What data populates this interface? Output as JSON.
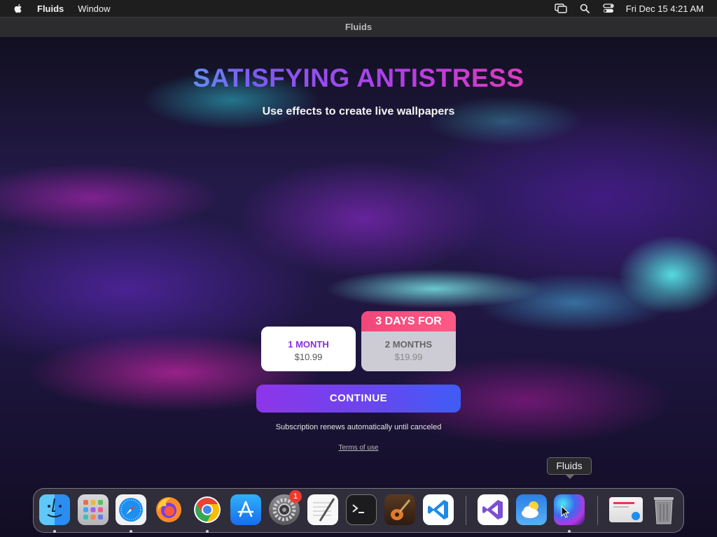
{
  "menubar": {
    "app_name": "Fluids",
    "items": [
      "Window"
    ],
    "clock": "Fri Dec 15  4:21 AM"
  },
  "window": {
    "title": "Fluids"
  },
  "paywall": {
    "headline": "SATISFYING ANTISTRESS",
    "subheadline": "Use effects to create live wallpapers",
    "plans": [
      {
        "name": "1 MONTH",
        "price": "$10.99",
        "selected": true
      },
      {
        "badge": "3 DAYS FOR",
        "name": "2 MONTHS",
        "price": "$19.99",
        "selected": false
      }
    ],
    "continue_label": "CONTINUE",
    "renew_note": "Subscription renews automatically until canceled",
    "terms_link": "Terms of use"
  },
  "tooltip": {
    "text": "Fluids"
  },
  "dock": {
    "apps": [
      {
        "name": "Finder",
        "icon": "finder-icon",
        "running": true
      },
      {
        "name": "Launchpad",
        "icon": "launchpad-icon",
        "running": false
      },
      {
        "name": "Safari",
        "icon": "safari-icon",
        "running": true
      },
      {
        "name": "Firefox",
        "icon": "firefox-icon",
        "running": false
      },
      {
        "name": "Chrome",
        "icon": "chrome-icon",
        "running": true
      },
      {
        "name": "App Store",
        "icon": "app-store-icon",
        "running": false
      },
      {
        "name": "System Settings",
        "icon": "settings-gear-icon",
        "running": false,
        "badge": "1"
      },
      {
        "name": "TextEdit",
        "icon": "textedit-icon",
        "running": false
      },
      {
        "name": "Terminal",
        "icon": "terminal-icon",
        "running": false
      },
      {
        "name": "GarageBand",
        "icon": "guitar-icon",
        "running": false
      },
      {
        "name": "VS Code",
        "icon": "vscode-icon",
        "running": false
      },
      {
        "name": "Visual Studio",
        "icon": "visual-studio-icon",
        "running": false
      },
      {
        "name": "Weather",
        "icon": "weather-icon",
        "running": false
      },
      {
        "name": "Fluids",
        "icon": "fluids-icon",
        "running": true
      },
      {
        "name": "Downloads",
        "icon": "downloads-folder-icon",
        "running": false
      },
      {
        "name": "Trash",
        "icon": "trash-icon",
        "running": false
      }
    ]
  },
  "colors": {
    "accent_purple": "#8a2be2",
    "badge_pink": "#f2467a",
    "continue_start": "#8e35e9",
    "continue_end": "#3f5cf5"
  }
}
